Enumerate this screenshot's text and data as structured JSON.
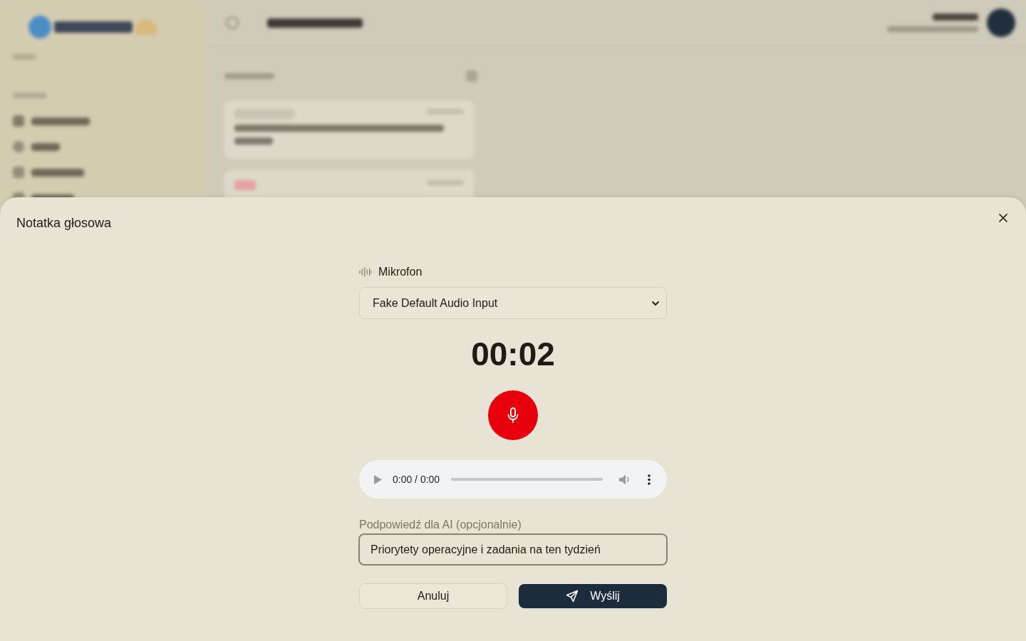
{
  "dialog": {
    "title": "Notatka głosowa"
  },
  "microphone": {
    "label": "Mikrofon",
    "selected_device": "Fake Default Audio Input"
  },
  "timer": "00:02",
  "record_button": {
    "recording": true
  },
  "audio_player": {
    "time": "0:00 / 0:00"
  },
  "hint_field": {
    "label": "Podpowiedź dla AI (opcjonalnie)",
    "value": "Priorytety operacyjne i zadania na ten tydzień",
    "focused": true
  },
  "buttons": [
    {
      "label": "Anuluj",
      "kind": "secondary"
    },
    {
      "label": "Wyślij",
      "kind": "primary"
    }
  ]
}
